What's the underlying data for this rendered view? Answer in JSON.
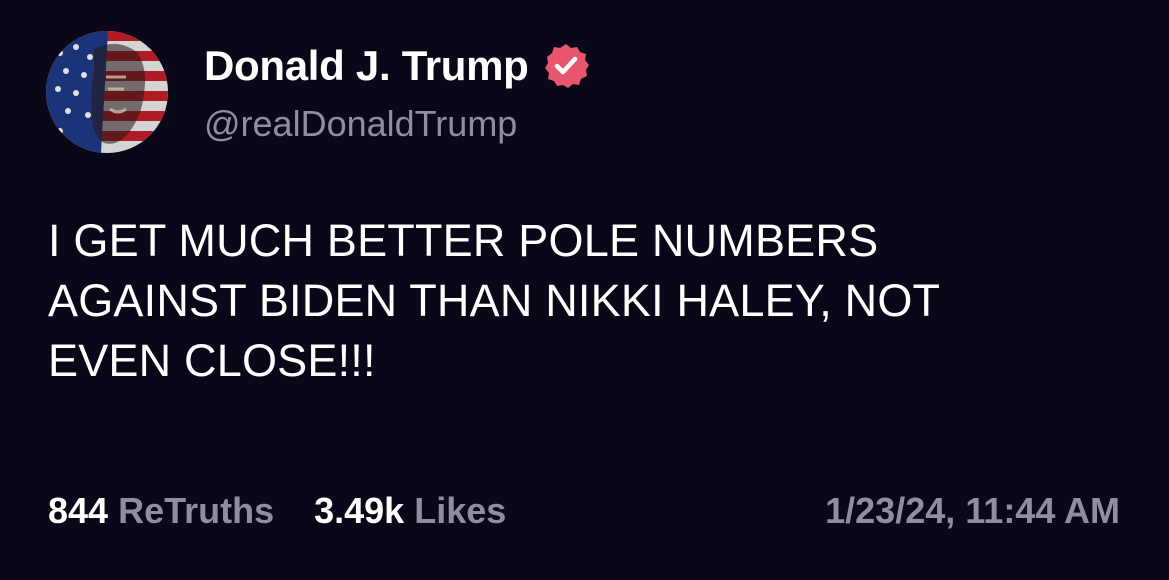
{
  "author": {
    "display_name": "Donald J. Trump",
    "handle": "@realDonaldTrump",
    "avatar_icon": "flag-portrait-avatar",
    "verified_icon": "verified-badge-icon",
    "verified_color": "#e8566e"
  },
  "post": {
    "text": "I GET MUCH BETTER POLE NUMBERS\nAGAINST BIDEN THAN NIKKI HALEY, NOT\nEVEN CLOSE!!!"
  },
  "stats": {
    "retruths_count": "844",
    "retruths_label": "ReTruths",
    "likes_count": "3.49k",
    "likes_label": "Likes"
  },
  "timestamp": "1/23/24, 11:44 AM",
  "colors": {
    "background": "#0a0719",
    "primary_text": "#ffffff",
    "secondary_text": "#8f8ca3"
  }
}
